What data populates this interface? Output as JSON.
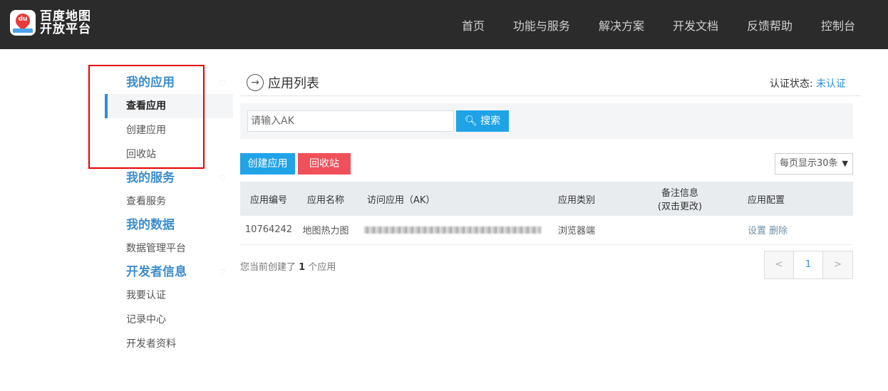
{
  "header": {
    "logo_line1": "百度地图",
    "logo_line2": "开放平台",
    "logo_badge": "du",
    "nav": [
      "首页",
      "功能与服务",
      "解决方案",
      "开发文档",
      "反馈帮助",
      "控制台"
    ]
  },
  "sidebar": {
    "groups": [
      {
        "title": "我的应用",
        "items": [
          "查看应用",
          "创建应用",
          "回收站"
        ]
      },
      {
        "title": "我的服务",
        "items": [
          "查看服务"
        ]
      },
      {
        "title": "我的数据",
        "items": [
          "数据管理平台"
        ]
      },
      {
        "title": "开发者信息",
        "items": [
          "我要认证",
          "记录中心",
          "开发者资料"
        ]
      }
    ],
    "active": "查看应用"
  },
  "main": {
    "title": "应用列表",
    "auth_label": "认证状态:",
    "auth_value": "未认证",
    "search_placeholder": "请输入AK",
    "search_button": "搜索",
    "create_button": "创建应用",
    "recycle_button": "回收站",
    "per_page": "每页显示30条",
    "table": {
      "headers": [
        "应用编号",
        "应用名称",
        "访问应用（AK）",
        "应用类别",
        "备注信息",
        "(双击更改)",
        "应用配置"
      ],
      "rows": [
        {
          "id": "10764242",
          "name": "地图热力图",
          "category": "浏览器端",
          "note": "",
          "config_set": "设置",
          "config_delete": "删除"
        }
      ]
    },
    "count_prefix": "您当前创建了",
    "count_value": "1",
    "count_suffix": "个应用",
    "pager": {
      "prev": "<",
      "current": "1",
      "next": ">"
    }
  },
  "colors": {
    "accent": "#2a8fd6",
    "danger": "#f0505a",
    "topbar": "#2b2b2b"
  }
}
